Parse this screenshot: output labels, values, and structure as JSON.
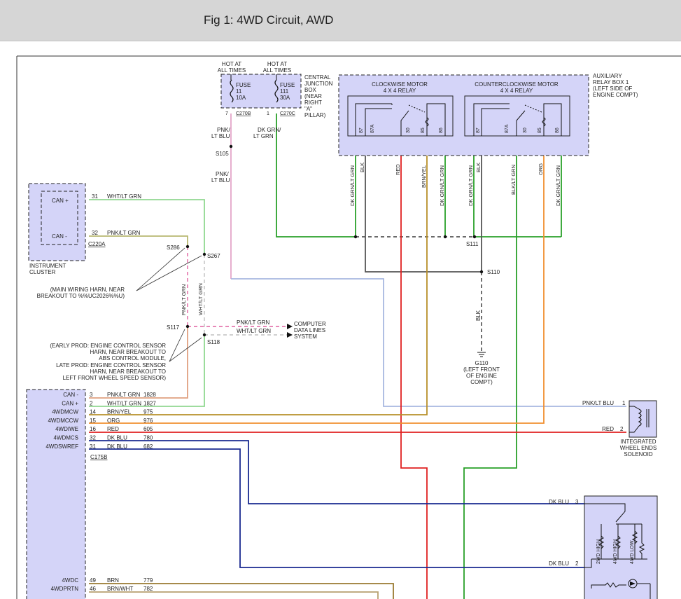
{
  "header": {
    "title": "Fig 1: 4WD Circuit, AWD"
  },
  "fuse_block": {
    "hot1a": "HOT AT",
    "hot1b": "ALL TIMES",
    "hot2a": "HOT AT",
    "hot2b": "ALL TIMES",
    "fuse1": [
      "FUSE",
      "11",
      "10A"
    ],
    "fuse2": [
      "FUSE",
      "111",
      "30A"
    ],
    "cjb": [
      "CENTRAL",
      "JUNCTION",
      "BOX",
      "(NEAR",
      "RIGHT",
      "\"A\"",
      "PILLAR)"
    ],
    "pin1": "7",
    "conn1": "C270B",
    "pin2": "1",
    "conn2": "C270C"
  },
  "relay_box": {
    "cw_title": [
      "CLOCKWISE MOTOR",
      "4 X 4 RELAY"
    ],
    "ccw_title": [
      "COUNTERCLOCKWISE MOTOR",
      "4 X 4 RELAY"
    ],
    "aux": [
      "AUXILIARY",
      "RELAY BOX 1",
      "(LEFT SIDE OF",
      "ENGINE COMPT)"
    ],
    "cw_pins": [
      "87",
      "87A",
      "30",
      "85",
      "86"
    ],
    "ccw_pins": [
      "87",
      "87A",
      "30",
      "85",
      "86"
    ]
  },
  "relay_wires": [
    "DK GRN/LT GRN",
    "BLK",
    "RED",
    "BRN/YEL",
    "DK GRN/LT GRN",
    "DK GRN/LT GRN",
    "BLK",
    "BLK/LT GRN",
    "ORG",
    "DK GRN/LT GRN"
  ],
  "splices": {
    "s105": "S105",
    "s111": "S111",
    "s110": "S110",
    "s286": "S286",
    "s267": "S267",
    "s117": "S117",
    "s118": "S118"
  },
  "wire_labels": {
    "pnk_ltblu_a": [
      "PNK/",
      "LT BLU"
    ],
    "dkgrn_ltgrn": [
      "DK GRN/",
      "LT GRN"
    ],
    "pnk_ltblu_b": [
      "PNK/",
      "LT BLU"
    ],
    "blk_vertical": "BLK",
    "pnk_lt_grn_v": "PNK/LT GRN",
    "wht_lt_grn_v": "WHT/LT GRN",
    "pnk_lt_grn_h": "PNK/LT GRN",
    "wht_lt_grn_h": "WHT/LT GRN"
  },
  "instrument_cluster": {
    "can_plus": "CAN +",
    "can_minus": "CAN -",
    "pin31": "31",
    "pin32": "32",
    "wire31": "WHT/LT GRN",
    "wire32": "PNK/LT GRN",
    "connector": "C220A",
    "label": [
      "INSTRUMENT",
      "CLUSTER"
    ]
  },
  "ground": {
    "id": "G110",
    "loc": [
      "(LEFT FRONT",
      "OF ENGINE",
      "COMPT)"
    ]
  },
  "computer_lines": [
    "COMPUTER",
    "DATA LINES",
    "SYSTEM"
  ],
  "main_harness_note": [
    "(MAIN WIRING HARN, NEAR",
    "BREAKOUT TO %%UC2026%%U)"
  ],
  "early_late_note": [
    "(EARLY PROD: ENGINE CONTROL SENSOR",
    "HARN, NEAR BREAKOUT TO",
    "ABS CONTROL MODULE,",
    "LATE PROD: ENGINE CONTROL SENSOR",
    "HARN, NEAR BREAKOUT TO",
    "LEFT FRONT WHEEL SPEED SENSOR)"
  ],
  "module": {
    "connector": "C175B",
    "rows": [
      {
        "name": "CAN -",
        "pin": "3",
        "color": "PNK/LT GRN",
        "circuit": "1828"
      },
      {
        "name": "CAN +",
        "pin": "2",
        "color": "WHT/LT GRN",
        "circuit": "1827"
      },
      {
        "name": "4WDMCW",
        "pin": "14",
        "color": "BRN/YEL",
        "circuit": "975"
      },
      {
        "name": "4WDMCCW",
        "pin": "15",
        "color": "ORG",
        "circuit": "976"
      },
      {
        "name": "4WDIWE",
        "pin": "16",
        "color": "RED",
        "circuit": "605"
      },
      {
        "name": "4WDMCS",
        "pin": "32",
        "color": "DK BLU",
        "circuit": "780"
      },
      {
        "name": "4WDSWREF",
        "pin": "31",
        "color": "DK BLU",
        "circuit": "682"
      }
    ],
    "rows_bottom": [
      {
        "name": "4WDC",
        "pin": "49",
        "color": "BRN",
        "circuit": "779"
      },
      {
        "name": "4WDPRTN",
        "pin": "46",
        "color": "BRN/WHT",
        "circuit": "782"
      }
    ]
  },
  "solenoid": {
    "wire1": "PNK/LT BLU",
    "pin1": "1",
    "wire2": "RED",
    "pin2": "2",
    "label": [
      "INTEGRATED",
      "WHEEL ENDS",
      "SOLENOID"
    ]
  },
  "mode_switch": {
    "wire3": "DK BLU",
    "pin3": "3",
    "wire2": "DK BLU",
    "pin2": "2",
    "resistors": [
      "2WD HIGH",
      "4WD HIGH",
      "4WD LOW"
    ]
  }
}
